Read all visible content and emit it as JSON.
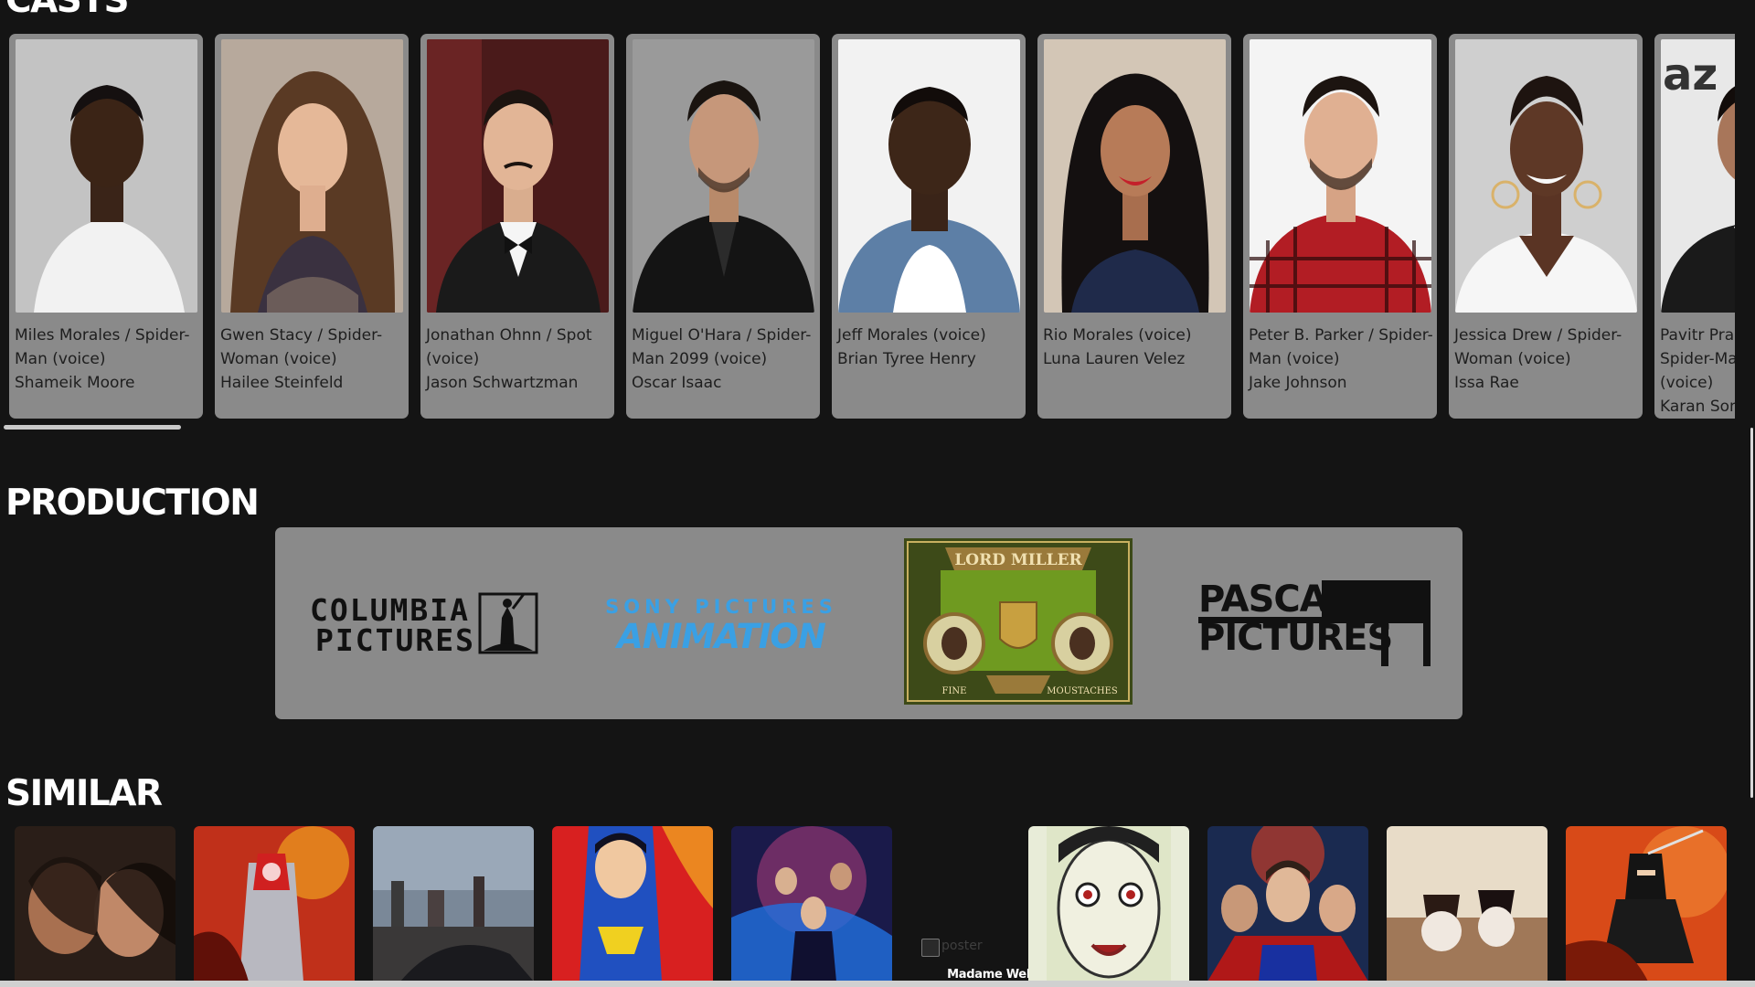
{
  "sections": {
    "casts_title": "CASTS",
    "production_title": "PRODUCTION",
    "similar_title": "SIMILAR"
  },
  "casts": [
    {
      "role": "Miles Morales / Spider-Man (voice)",
      "actor": "Shameik Moore"
    },
    {
      "role": "Gwen Stacy / Spider-Woman (voice)",
      "actor": "Hailee Steinfeld"
    },
    {
      "role": "Jonathan Ohnn / Spot (voice)",
      "actor": "Jason Schwartzman"
    },
    {
      "role": "Miguel O'Hara / Spider-Man 2099 (voice)",
      "actor": "Oscar Isaac"
    },
    {
      "role": "Jeff Morales (voice)",
      "actor": "Brian Tyree Henry"
    },
    {
      "role": "Rio Morales (voice)",
      "actor": "Luna Lauren Velez"
    },
    {
      "role": "Peter B. Parker / Spider-Man (voice)",
      "actor": "Jake Johnson"
    },
    {
      "role": "Jessica Drew / Spider-Woman (voice)",
      "actor": "Issa Rae"
    },
    {
      "role": "Pavitr Prabhakar / Spider-Man India (voice)",
      "actor": "Karan Soni"
    }
  ],
  "production": {
    "columbia": {
      "line1": "COLUMBIA",
      "line2": "PICTURES"
    },
    "sony": {
      "line1": "SONY PICTURES",
      "line2": "ANIMATION"
    },
    "lordmiller": {
      "banner": "LORD MILLER",
      "left": "FINE",
      "right": "MOUSTACHES"
    },
    "pascal": {
      "line1": "PASCAL",
      "line2": "PICTURES"
    }
  },
  "similar": {
    "broken_alt": "poster",
    "broken_title": "Madame Web"
  },
  "colors": {
    "background": "#141414",
    "card": "#8a8a8a",
    "sony_blue": "#3aa0e4",
    "text_dark": "#1e1e1e"
  }
}
